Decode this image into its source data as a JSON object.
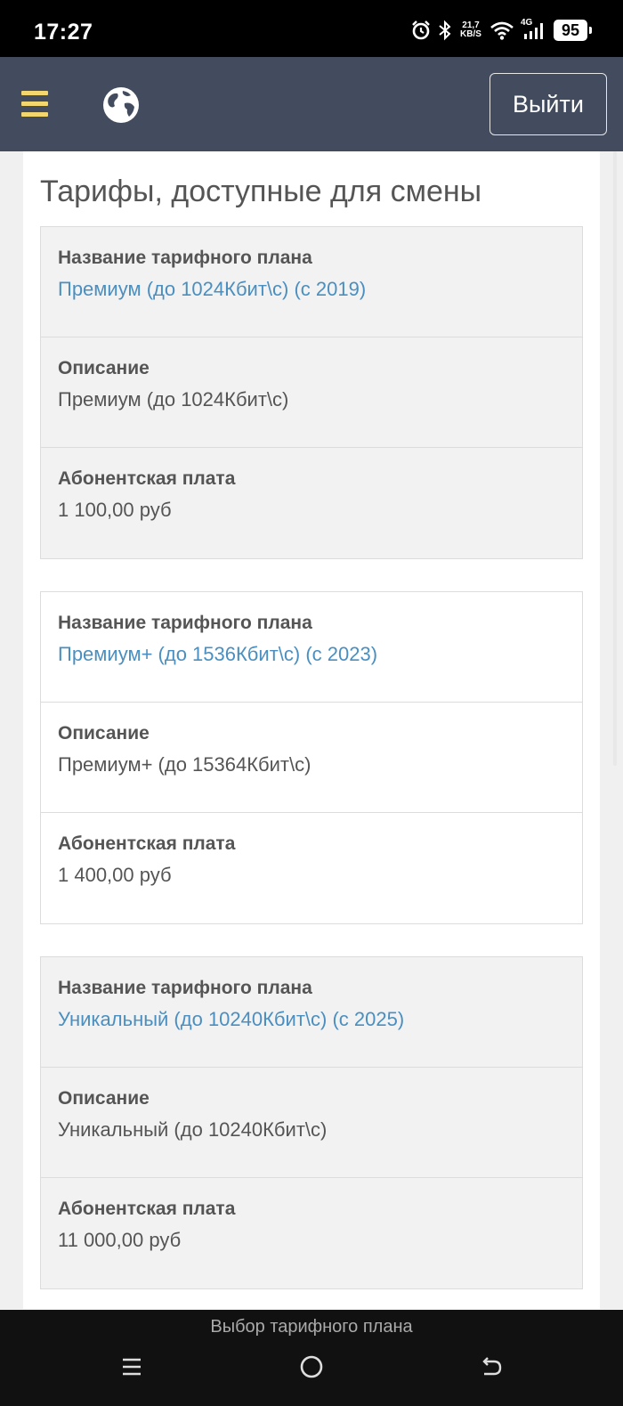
{
  "status_bar": {
    "time": "17:27",
    "net_speed_value": "21,7",
    "net_speed_unit": "KB/S",
    "network_type": "4G",
    "battery": "95"
  },
  "header": {
    "logout_label": "Выйти",
    "accent_color": "#f4d66f",
    "background_color": "#434c5e"
  },
  "page": {
    "title": "Тарифы, доступные для смены"
  },
  "plans": [
    {
      "name_label": "Название тарифного плана",
      "name": "Премиум (до 1024Кбит\\с) (с 2019)",
      "description_label": "Описание",
      "description": "Премиум (до 1024Кбит\\с)",
      "fee_label": "Абонентская плата",
      "fee": "1 100,00  руб"
    },
    {
      "name_label": "Название тарифного плана",
      "name": "Премиум+ (до 1536Кбит\\с) (с 2023)",
      "description_label": "Описание",
      "description": "Премиум+ (до 15364Кбит\\с)",
      "fee_label": "Абонентская плата",
      "fee": "1 400,00  руб"
    },
    {
      "name_label": "Название тарифного плана",
      "name": "Уникальный (до 10240Кбит\\с) (с 2025)",
      "description_label": "Описание",
      "description": "Уникальный (до 10240Кбит\\с)",
      "fee_label": "Абонентская плата",
      "fee": "11 000,00  руб"
    }
  ],
  "nav_bar": {
    "caption": "Выбор тарифного плана"
  }
}
